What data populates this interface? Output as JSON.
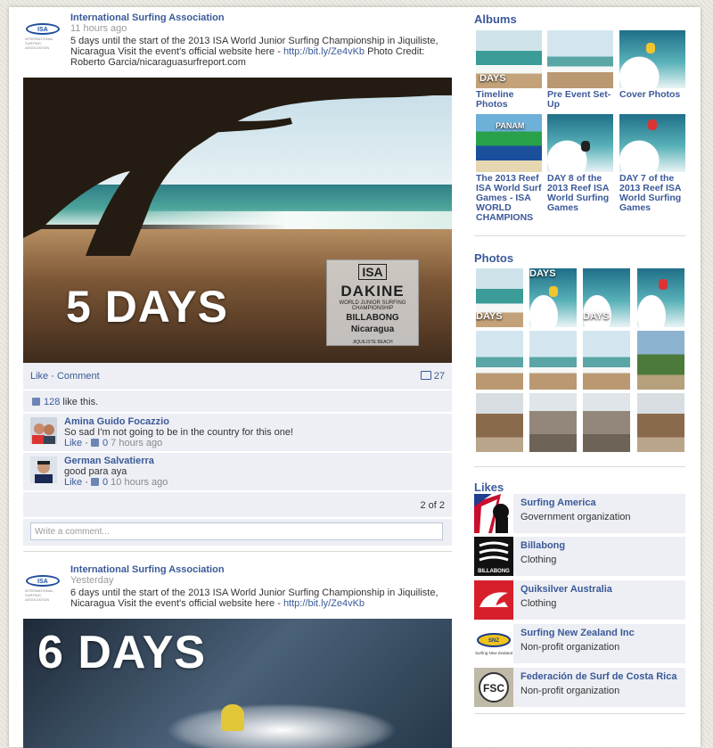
{
  "posts": [
    {
      "author": "International Surfing Association",
      "time": "11 hours ago",
      "message_prefix": "5 days until the start of the 2013 ISA World Junior Surfing Championship in Jiquiliste, Nicaragua Visit the event's official website here - ",
      "link": "http://bit.ly/Ze4vKb",
      "message_suffix": " Photo Credit: Roberto Garcia/nicaraguasurfreport.com",
      "image_overlay": "5 DAYS",
      "badge": {
        "top": "ISA",
        "brand": "DAKINE",
        "sub": "WORLD JUNIOR SURFING CHAMPIONSHIP",
        "sponsor": "BILLABONG",
        "country": "Nicaragua",
        "place": "JIQUILISTE BEACH"
      },
      "actions": {
        "like": "Like",
        "dot": "·",
        "comment": "Comment",
        "comment_count": "27"
      },
      "likes": {
        "count": "128",
        "suffix": " like this."
      },
      "comments": [
        {
          "name": "Amina Guido Focazzio",
          "text": "So sad I'm not going to be in the country for this one!",
          "like": "Like",
          "dot": "·",
          "likes": "0",
          "time": "7 hours ago"
        },
        {
          "name": "German Salvatierra",
          "text": "good para aya",
          "like": "Like",
          "dot": "·",
          "likes": "0",
          "time": "10 hours ago"
        }
      ],
      "pager": "2 of 2",
      "comment_placeholder": "Write a comment..."
    },
    {
      "author": "International Surfing Association",
      "time": "Yesterday",
      "message_prefix": "6 days until the start of the 2013 ISA World Junior Surfing Championship in Jiquiliste, Nicaragua Visit the event's official website here - ",
      "link": "http://bit.ly/Ze4vKb",
      "image_overlay": "6 DAYS"
    }
  ],
  "sidebar": {
    "albums_title": "Albums",
    "albums": [
      {
        "caption": "Timeline Photos",
        "overlay": "DAYS"
      },
      {
        "caption": "Pre Event Set-Up"
      },
      {
        "caption": "Cover Photos"
      },
      {
        "caption": "The 2013 Reef ISA World Surf Games - ISA WORLD CHAMPIONS",
        "overlay": "PANAM"
      },
      {
        "caption": "DAY 8 of the 2013 Reef ISA World Surfing Games"
      },
      {
        "caption": "DAY 7 of the 2013 Reef ISA World Surfing Games"
      }
    ],
    "photos_title": "Photos",
    "photo_overlays": [
      "DAYS",
      "DAYS",
      "DAYS"
    ],
    "likes_title": "Likes",
    "likes": [
      {
        "name": "Surfing America",
        "category": "Government organization",
        "logo_text": ""
      },
      {
        "name": "Billabong",
        "category": "Clothing",
        "logo_text": "BILLABONG"
      },
      {
        "name": "Quiksilver Australia",
        "category": "Clothing",
        "logo_text": ""
      },
      {
        "name": "Surfing New Zealand Inc",
        "category": "Non-profit organization",
        "logo_text": "Surfing New Zealand"
      },
      {
        "name": "Federación de Surf de Costa Rica",
        "category": "Non-profit organization",
        "logo_text": "FSC"
      }
    ]
  },
  "isa_logo_text": "ISA",
  "colors": {
    "link": "#3b5998",
    "panel": "#edeff4",
    "muted": "#999999"
  }
}
